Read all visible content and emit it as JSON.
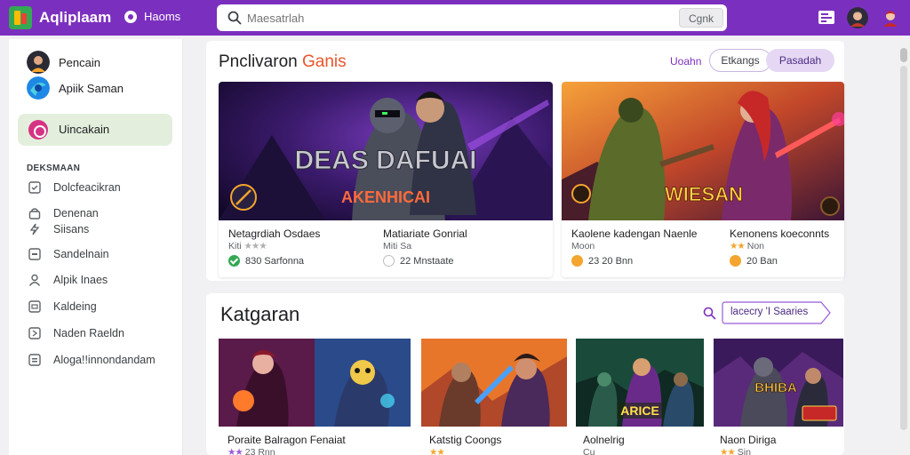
{
  "app": {
    "title": "Aqliplaam",
    "home_label": "Haoms"
  },
  "search": {
    "placeholder": "Maesatrlah",
    "button_label": "Cgnk"
  },
  "sidebar": {
    "users": [
      {
        "name": "Pencain"
      },
      {
        "name": "Apiik Saman"
      }
    ],
    "active_item": "Uincakain",
    "section_title": "DEKSMAAN",
    "items": [
      {
        "label": "Dolcfeacikran",
        "icon": "shield-icon"
      },
      {
        "label": "Denenan",
        "icon": "lock-icon"
      },
      {
        "label": "Siisans",
        "icon": "bolt-icon"
      },
      {
        "label": "Sandelnain",
        "icon": "square-icon"
      },
      {
        "label": "Alpik Inaes",
        "icon": "person-icon"
      },
      {
        "label": "Kaldeing",
        "icon": "box-icon"
      },
      {
        "label": "Naden Raeldn",
        "icon": "box-icon"
      },
      {
        "label": "Aloga!!innondandam",
        "icon": "doc-icon"
      }
    ]
  },
  "featured": {
    "title_main": "Pnclivaron",
    "title_accent": "Ganis",
    "filter_link": "Uoahn",
    "pill_1": "Etkangs",
    "pill_2": "Pasadah",
    "cards": [
      {
        "banner_title": "DEAS DAFUAI",
        "banner_subtitle": "AKENHICAI",
        "col1_title": "Netagrdiah Osdaes",
        "col1_meta": "Kiti",
        "col1_stars": "★★★",
        "col1_stat": "830 Sarfonna",
        "col2_title": "Matiariate Gonrial",
        "col2_meta": "Miti Sa",
        "col2_stat": "22 Mnstaate"
      },
      {
        "banner_title": "WIESAN",
        "col1_title": "Kaolene kadengan Naenle",
        "col1_meta": "Moon",
        "col1_stat": "23 20 Bnn",
        "col2_title": "Kenonens koeconnts",
        "col2_meta": "Non",
        "col2_stars": "★★",
        "col2_stat": "20 Ban"
      }
    ]
  },
  "categories": {
    "title": "Katgaran",
    "button_label": "lacecry 'I Saaries",
    "tiles": [
      {
        "title": "Poraite Balragon Fenaiat",
        "meta": "23 Rnn",
        "stars": "★★"
      },
      {
        "title": "Katstig Coongs",
        "meta": "",
        "stars": "★★"
      },
      {
        "title": "Aolnelrig",
        "meta": "Cu",
        "stars": ""
      },
      {
        "title": "Naon Diriga",
        "meta": "Sin",
        "stars": "★★"
      }
    ],
    "tile_badges": [
      "ARICE",
      "BHIBA"
    ]
  },
  "colors": {
    "topbar": "#7b2fbf",
    "accent_orange": "#e8552b",
    "active_sidebar": "#e3efdc"
  }
}
